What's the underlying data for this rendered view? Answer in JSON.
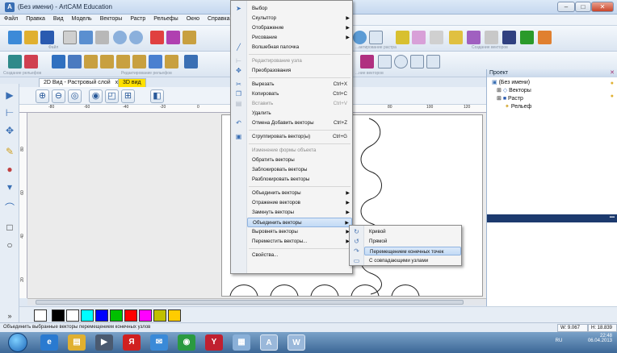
{
  "window": {
    "title": "(Без имени) - ArtCAM Education",
    "app_icon": "artcam-icon",
    "controls": {
      "minimize": "–",
      "maximize": "□",
      "close": "✕"
    }
  },
  "menubar": [
    "Файл",
    "Правка",
    "Вид",
    "Модель",
    "Векторы",
    "Растр",
    "Рельефы",
    "Окно",
    "Справка"
  ],
  "toolbar_groups": {
    "file": "Файл",
    "relief_create": "Создание рельефов",
    "relief_edit": "Редактирование рельефов",
    "raster_edit": "...актирование растра",
    "vector_create": "Создание векторов",
    "vector_edit": "...ние векторов"
  },
  "tabs": [
    {
      "label": "2D Вид - Растровый слой",
      "close": "x",
      "active": true
    },
    {
      "label": "3D вид",
      "active": false
    }
  ],
  "ruler_h": [
    "-80",
    "-60",
    "-40",
    "-20",
    "0",
    "80",
    "100",
    "120"
  ],
  "ruler_v": [
    "80",
    "60",
    "40",
    "20",
    "0"
  ],
  "project_panel": {
    "title": "Проект",
    "root": "(Без имени)",
    "items": [
      "Векторы",
      "Растр",
      "Рельеф"
    ]
  },
  "context_menu": {
    "items": [
      {
        "label": "Выбор",
        "icon": "cursor-icon",
        "enabled": true
      },
      {
        "label": "Скульптор",
        "enabled": true,
        "submenu": true
      },
      {
        "label": "Отображение",
        "enabled": true,
        "submenu": true
      },
      {
        "label": "Рисование",
        "enabled": true,
        "submenu": true
      },
      {
        "label": "Волшебная палочка",
        "icon": "magic-wand-icon",
        "enabled": true
      },
      {
        "sep": true
      },
      {
        "label": "Редактирование узла",
        "icon": "node-edit-icon",
        "enabled": false
      },
      {
        "label": "Преобразования",
        "icon": "transform-icon",
        "enabled": true
      },
      {
        "sep": true
      },
      {
        "label": "Вырезать",
        "icon": "cut-icon",
        "shortcut": "Ctrl+X",
        "enabled": true
      },
      {
        "label": "Копировать",
        "icon": "copy-icon",
        "shortcut": "Ctrl+C",
        "enabled": true
      },
      {
        "label": "Вставить",
        "icon": "paste-icon",
        "shortcut": "Ctrl+V",
        "enabled": false
      },
      {
        "label": "Удалить",
        "enabled": true
      },
      {
        "label": "Отмена Добавить векторы",
        "icon": "undo-icon",
        "shortcut": "Ctrl+Z",
        "enabled": true
      },
      {
        "sep": true
      },
      {
        "label": "Сгруппировать вектор(ы)",
        "icon": "group-icon",
        "shortcut": "Ctrl+G",
        "enabled": true
      },
      {
        "sep": true
      },
      {
        "label": "Изменение формы объекта",
        "enabled": false
      },
      {
        "label": "Обратить векторы",
        "enabled": true
      },
      {
        "label": "Заблокировать векторы",
        "enabled": true
      },
      {
        "label": "Разблокировать векторы",
        "enabled": true
      },
      {
        "sep": true
      },
      {
        "label": "Объединить векторы",
        "enabled": true,
        "submenu": true
      },
      {
        "label": "Отражение векторов",
        "enabled": true,
        "submenu": true
      },
      {
        "label": "Замкнуть векторы",
        "enabled": true,
        "submenu": true
      },
      {
        "label": "Объединить векторы",
        "enabled": true,
        "submenu": true,
        "highlighted": true
      },
      {
        "label": "Выровнять векторы",
        "enabled": true,
        "submenu": true
      },
      {
        "label": "Переместить векторы...",
        "enabled": true,
        "submenu": true
      },
      {
        "sep": true
      },
      {
        "label": "Свойства...",
        "enabled": true
      }
    ]
  },
  "submenu": {
    "items": [
      {
        "label": "Кривой",
        "icon": "curve-icon"
      },
      {
        "label": "Прямой",
        "icon": "line-icon"
      },
      {
        "label": "Перемещением конечных точек",
        "icon": "move-endpoints-icon",
        "highlighted": true
      },
      {
        "label": "С совпадающими узлами",
        "icon": "matching-nodes-icon"
      }
    ]
  },
  "palette": [
    "#000000",
    "#ffffff",
    "#00ffff",
    "#0000ff",
    "#00c000",
    "#ff0000",
    "#ff00ff",
    "#c0c000",
    "#ffcc00"
  ],
  "status": {
    "text": "Объединить выбранные векторы перемещением конечных узлов",
    "w": "W: 9.067",
    "h": "H: 18.839"
  },
  "taskbar": {
    "lang": "RU",
    "time": "22:48",
    "date": "06.04.2013"
  }
}
